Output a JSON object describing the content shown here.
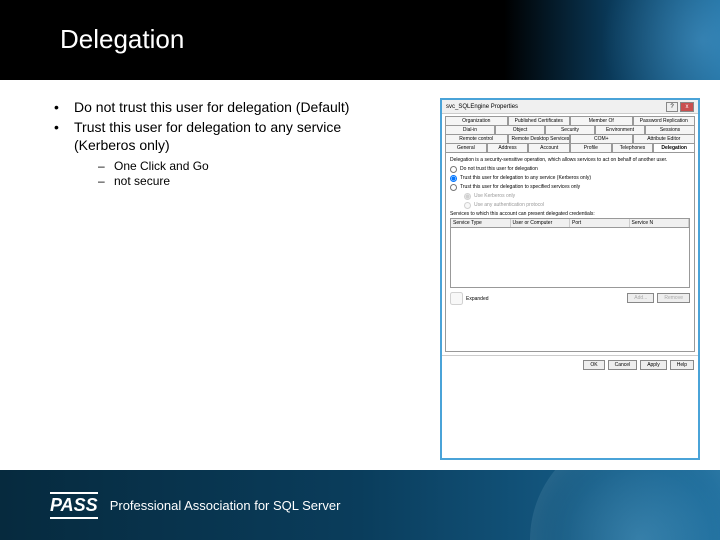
{
  "slide": {
    "title": "Delegation",
    "bullets": [
      "Do not trust this user for delegation (Default)",
      "Trust this user for delegation to any service (Kerberos only)"
    ],
    "sub_bullets": [
      "One Click and Go",
      "not secure"
    ]
  },
  "dialog": {
    "title": "svc_SQLEngine Properties",
    "help_btn": "?",
    "close_btn": "x",
    "tab_rows": [
      [
        "Organization",
        "Published Certificates",
        "Member Of",
        "Password Replication"
      ],
      [
        "Dial-in",
        "Object",
        "Security",
        "Environment",
        "Sessions"
      ],
      [
        "Remote control",
        "Remote Desktop Services Profile",
        "COM+",
        "Attribute Editor"
      ],
      [
        "General",
        "Address",
        "Account",
        "Profile",
        "Telephones",
        "Delegation"
      ]
    ],
    "active_tab": "Delegation",
    "description": "Delegation is a security-sensitive operation, which allows services to act on behalf of another user.",
    "options": [
      "Do not trust this user for delegation",
      "Trust this user for delegation to any service (Kerberos only)",
      "Trust this user for delegation to specified services only"
    ],
    "selected_option": 1,
    "sub_options": [
      "Use Kerberos only",
      "Use any authentication protocol"
    ],
    "sub_selected": 0,
    "services_label": "Services to which this account can present delegated credentials:",
    "table_headers": [
      "Service Type",
      "User or Computer",
      "Port",
      "Service N"
    ],
    "expanded_checkbox": "Expanded",
    "add_btn": "Add...",
    "remove_btn": "Remove",
    "footer_buttons": [
      "OK",
      "Cancel",
      "Apply",
      "Help"
    ]
  },
  "footer": {
    "logo_mark": "PASS",
    "logo_text": "Professional Association for SQL Server"
  }
}
